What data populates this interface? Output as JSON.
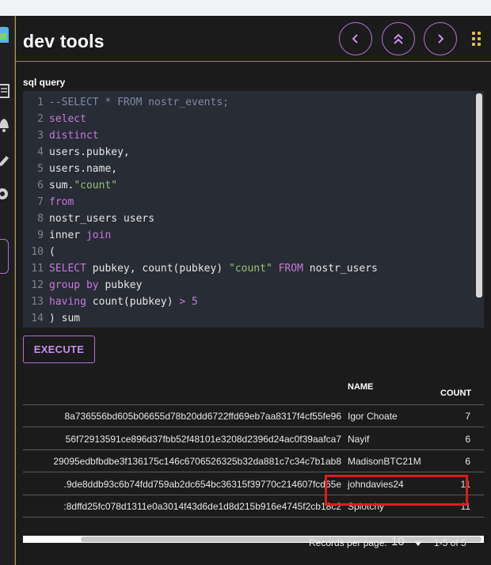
{
  "app": {
    "title": "dev tools"
  },
  "nav": {
    "prev_label": "previous",
    "top_label": "scroll to top",
    "next_label": "next"
  },
  "sidebar": {
    "icons": [
      "app-icon",
      "document-icon",
      "bell-icon",
      "edit-icon",
      "gear-icon"
    ]
  },
  "editor": {
    "label": "sql query",
    "lines": [
      {
        "num": "1",
        "tokens": [
          {
            "t": "--SELECT * FROM nostr_events;",
            "c": "comment"
          }
        ]
      },
      {
        "num": "2",
        "tokens": [
          {
            "t": "select",
            "c": "kw"
          }
        ]
      },
      {
        "num": "3",
        "tokens": [
          {
            "t": "distinct",
            "c": "kw"
          }
        ]
      },
      {
        "num": "4",
        "tokens": [
          {
            "t": "users.pubkey,",
            "c": "plain"
          }
        ]
      },
      {
        "num": "5",
        "tokens": [
          {
            "t": "users.name,",
            "c": "plain"
          }
        ]
      },
      {
        "num": "6",
        "tokens": [
          {
            "t": "sum.",
            "c": "plain"
          },
          {
            "t": "\"count\"",
            "c": "str"
          }
        ]
      },
      {
        "num": "7",
        "tokens": [
          {
            "t": "from",
            "c": "kw"
          }
        ]
      },
      {
        "num": "8",
        "tokens": [
          {
            "t": "nostr_users users",
            "c": "plain"
          }
        ]
      },
      {
        "num": "9",
        "tokens": [
          {
            "t": "inner ",
            "c": "plain"
          },
          {
            "t": "join",
            "c": "kw"
          }
        ]
      },
      {
        "num": "10",
        "tokens": [
          {
            "t": "(",
            "c": "plain"
          }
        ]
      },
      {
        "num": "11",
        "tokens": [
          {
            "t": "SELECT",
            "c": "kw"
          },
          {
            "t": " pubkey, count(pubkey) ",
            "c": "plain"
          },
          {
            "t": "\"count\"",
            "c": "str"
          },
          {
            "t": " FROM",
            "c": "kw"
          },
          {
            "t": " nostr_users",
            "c": "plain"
          }
        ]
      },
      {
        "num": "12",
        "tokens": [
          {
            "t": "group by",
            "c": "kw"
          },
          {
            "t": " pubkey",
            "c": "plain"
          }
        ]
      },
      {
        "num": "13",
        "tokens": [
          {
            "t": "having",
            "c": "kw"
          },
          {
            "t": " count(pubkey) ",
            "c": "plain"
          },
          {
            "t": ">",
            "c": "kw"
          },
          {
            "t": " 5",
            "c": "num"
          }
        ]
      },
      {
        "num": "14",
        "tokens": [
          {
            "t": ") sum",
            "c": "plain"
          }
        ]
      }
    ]
  },
  "execute_label": "EXECUTE",
  "table": {
    "columns": {
      "name": "NAME",
      "count": "COUNT"
    },
    "rows": [
      {
        "pubkey": "8a736556bd605b06655d78b20dd6722ffd69eb7aa8317f4cf55fe96",
        "name": "Igor Choate",
        "count": "7"
      },
      {
        "pubkey": "56f72913591ce896d37fbb52f48101e3208d2396d24ac0f39aafca7",
        "name": "Nayif",
        "count": "6"
      },
      {
        "pubkey": "29095edbfbdbe3f136175c146c6706526325b32da881c7c34c7b1ab8",
        "name": "MadisonBTC21M",
        "count": "6"
      },
      {
        "pubkey": ".9de8ddb93c6b74fdd759ab2dc654bc36315f39770c214607fcd65e",
        "name": "johndavies24",
        "count": "11"
      },
      {
        "pubkey": ":8dffd25fc078d1311e0a3014f43d6de1d8d215b916e4745f2cb18c2",
        "name": "Splotchy",
        "count": "11"
      }
    ]
  },
  "pagination": {
    "rows_per_page_label": "Records per page:",
    "rows_per_page_value": "10",
    "range": "1-5 of 5"
  },
  "colors": {
    "accent": "#b06fd8",
    "keyword": "#c678dd",
    "string": "#98c379",
    "comment": "#7f8aa8",
    "highlight": "#e01b1b"
  }
}
